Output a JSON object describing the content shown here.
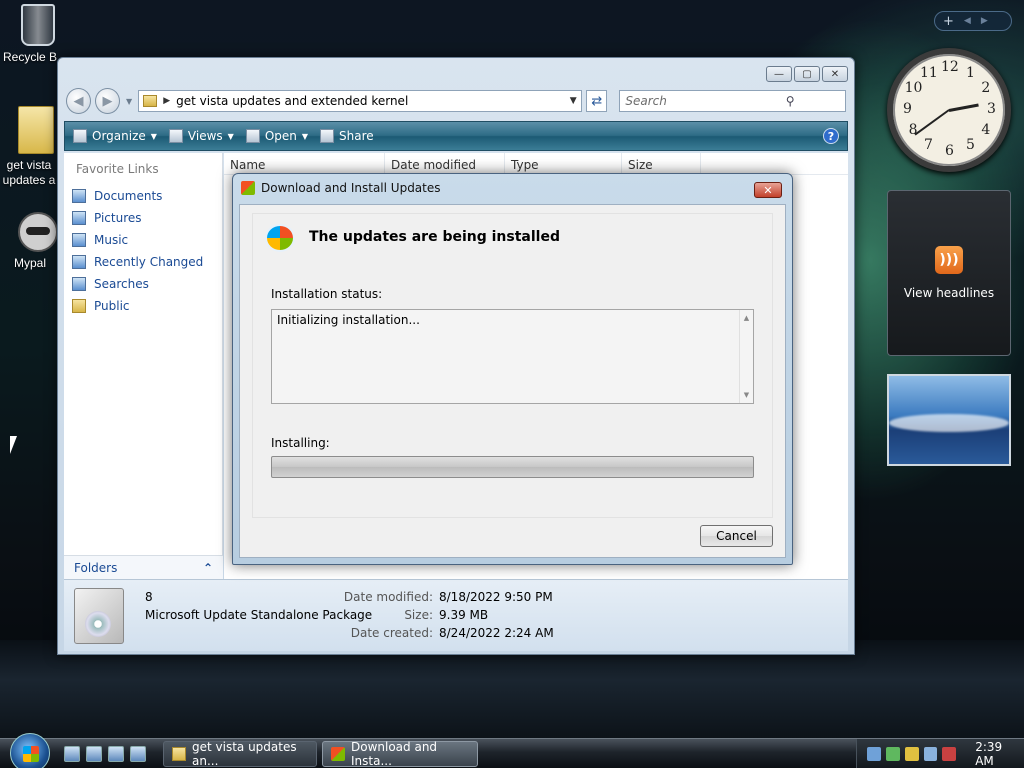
{
  "desktop": {
    "icons": [
      {
        "label": "Recycle Bin",
        "name": "recycle-bin"
      },
      {
        "label": "get vista updates a",
        "name": "folder-shortcut"
      },
      {
        "label": "Mypal",
        "name": "mypal"
      }
    ]
  },
  "explorer": {
    "address_path": "get vista updates and extended kernel",
    "search_placeholder": "Search",
    "toolbar": {
      "organize": "Organize",
      "views": "Views",
      "open": "Open",
      "share": "Share"
    },
    "favorite_links_title": "Favorite Links",
    "favorite_links": [
      "Documents",
      "Pictures",
      "Music",
      "Recently Changed",
      "Searches",
      "Public"
    ],
    "folders_label": "Folders",
    "columns": [
      "Name",
      "Date modified",
      "Type",
      "Size"
    ],
    "details": {
      "name": "8",
      "type": "Microsoft Update Standalone Package",
      "date_modified_label": "Date modified:",
      "date_modified": "8/18/2022 9:50 PM",
      "size_label": "Size:",
      "size": "9.39 MB",
      "date_created_label": "Date created:",
      "date_created": "8/24/2022 2:24 AM"
    }
  },
  "dialog": {
    "title": "Download and Install Updates",
    "heading": "The updates are being installed",
    "status_label": "Installation status:",
    "status_text": "Initializing installation...",
    "installing_label": "Installing:",
    "progress_percent": 0,
    "cancel_label": "Cancel"
  },
  "gadgets": {
    "clock_numbers": [
      "12",
      "1",
      "2",
      "3",
      "4",
      "5",
      "6",
      "7",
      "8",
      "9",
      "10",
      "11"
    ],
    "news_label": "View headlines"
  },
  "taskbar": {
    "tasks": [
      {
        "label": "get vista updates an...",
        "icon": "folder-icon"
      },
      {
        "label": "Download and Insta...",
        "icon": "windows-update-icon"
      }
    ],
    "time": "2:39 AM"
  }
}
